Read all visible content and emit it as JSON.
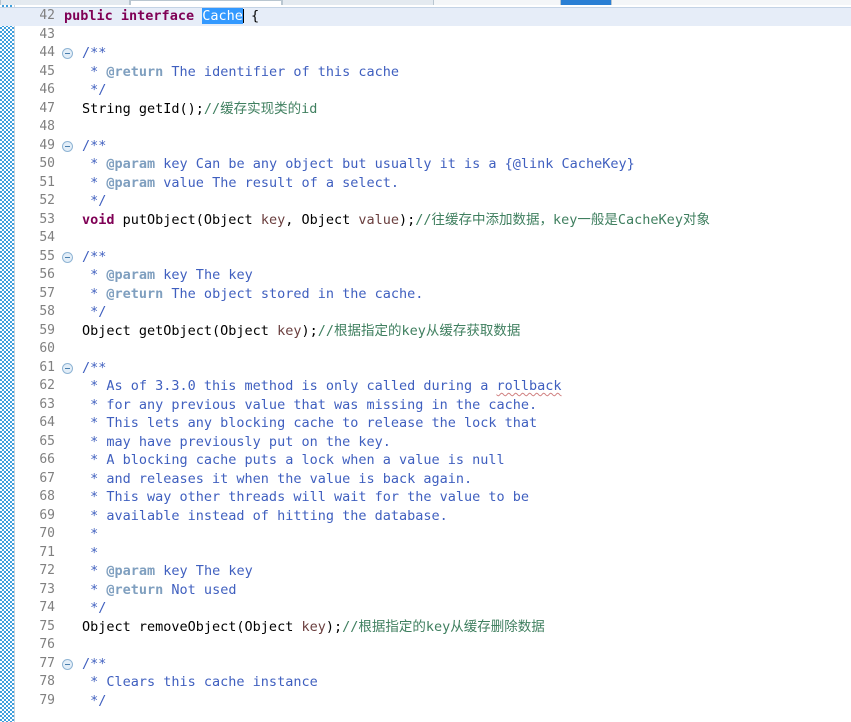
{
  "window": {
    "app": "eclipse-java-editor",
    "colors": {
      "keyword": "#7f0055",
      "javadoc": "#3f5fbf",
      "javadoc_tag": "#7f9fbf",
      "line_comment": "#3f7f5f",
      "parameter": "#6a3e3e",
      "selection_bg": "#3399ff",
      "current_line_bg": "#e6edf8",
      "line_number": "#808080",
      "change_bar": "#1e8fd8"
    }
  },
  "tabs": [
    {
      "label": "",
      "state": "inactive"
    },
    {
      "label": "",
      "state": "active"
    },
    {
      "label": "",
      "state": "inactive"
    },
    {
      "label": "",
      "state": "selected"
    }
  ],
  "editor": {
    "selected_text": "Cache",
    "current_line": 42,
    "first_visible_line": 42,
    "last_visible_line": 79,
    "lines": [
      {
        "n": "42",
        "fold": false,
        "indent": 0,
        "current": true,
        "tokens": [
          {
            "t": "public",
            "c": "kw"
          },
          {
            "t": " ",
            "c": "plain"
          },
          {
            "t": "interface",
            "c": "kw"
          },
          {
            "t": " ",
            "c": "plain"
          },
          {
            "t": "Cache",
            "c": "selected"
          },
          {
            "t": "caret",
            "c": "caret"
          },
          {
            "t": " {",
            "c": "plain"
          }
        ]
      },
      {
        "n": "43",
        "fold": false,
        "indent": 0,
        "current": false,
        "tokens": []
      },
      {
        "n": "44",
        "fold": true,
        "indent": 1,
        "current": false,
        "tokens": [
          {
            "t": "/**",
            "c": "doc"
          }
        ]
      },
      {
        "n": "45",
        "fold": false,
        "indent": 1,
        "current": false,
        "tokens": [
          {
            "t": " * ",
            "c": "doc"
          },
          {
            "t": "@return",
            "c": "doctag"
          },
          {
            "t": " The identifier of this cache",
            "c": "doc"
          }
        ]
      },
      {
        "n": "46",
        "fold": false,
        "indent": 1,
        "current": false,
        "tokens": [
          {
            "t": " */",
            "c": "doc"
          }
        ]
      },
      {
        "n": "47",
        "fold": false,
        "indent": 1,
        "current": false,
        "tokens": [
          {
            "t": "String getId();",
            "c": "plain"
          },
          {
            "t": "//缓存实现类的id",
            "c": "cmt"
          }
        ]
      },
      {
        "n": "48",
        "fold": false,
        "indent": 0,
        "current": false,
        "tokens": []
      },
      {
        "n": "49",
        "fold": true,
        "indent": 1,
        "current": false,
        "tokens": [
          {
            "t": "/**",
            "c": "doc"
          }
        ]
      },
      {
        "n": "50",
        "fold": false,
        "indent": 1,
        "current": false,
        "tokens": [
          {
            "t": " * ",
            "c": "doc"
          },
          {
            "t": "@param",
            "c": "doctag"
          },
          {
            "t": " key Can be any object but usually it is a {@link CacheKey}",
            "c": "doc"
          }
        ]
      },
      {
        "n": "51",
        "fold": false,
        "indent": 1,
        "current": false,
        "tokens": [
          {
            "t": " * ",
            "c": "doc"
          },
          {
            "t": "@param",
            "c": "doctag"
          },
          {
            "t": " value The result of a select.",
            "c": "doc"
          }
        ]
      },
      {
        "n": "52",
        "fold": false,
        "indent": 1,
        "current": false,
        "tokens": [
          {
            "t": " */",
            "c": "doc"
          }
        ]
      },
      {
        "n": "53",
        "fold": false,
        "indent": 1,
        "current": false,
        "tokens": [
          {
            "t": "void",
            "c": "kw"
          },
          {
            "t": " putObject(Object ",
            "c": "plain"
          },
          {
            "t": "key",
            "c": "param"
          },
          {
            "t": ", Object ",
            "c": "plain"
          },
          {
            "t": "value",
            "c": "param"
          },
          {
            "t": ");",
            "c": "plain"
          },
          {
            "t": "//往缓存中添加数据，key一般是CacheKey对象",
            "c": "cmt"
          }
        ]
      },
      {
        "n": "54",
        "fold": false,
        "indent": 0,
        "current": false,
        "tokens": []
      },
      {
        "n": "55",
        "fold": true,
        "indent": 1,
        "current": false,
        "tokens": [
          {
            "t": "/**",
            "c": "doc"
          }
        ]
      },
      {
        "n": "56",
        "fold": false,
        "indent": 1,
        "current": false,
        "tokens": [
          {
            "t": " * ",
            "c": "doc"
          },
          {
            "t": "@param",
            "c": "doctag"
          },
          {
            "t": " key The key",
            "c": "doc"
          }
        ]
      },
      {
        "n": "57",
        "fold": false,
        "indent": 1,
        "current": false,
        "tokens": [
          {
            "t": " * ",
            "c": "doc"
          },
          {
            "t": "@return",
            "c": "doctag"
          },
          {
            "t": " The object stored in the cache.",
            "c": "doc"
          }
        ]
      },
      {
        "n": "58",
        "fold": false,
        "indent": 1,
        "current": false,
        "tokens": [
          {
            "t": " */",
            "c": "doc"
          }
        ]
      },
      {
        "n": "59",
        "fold": false,
        "indent": 1,
        "current": false,
        "tokens": [
          {
            "t": "Object getObject(Object ",
            "c": "plain"
          },
          {
            "t": "key",
            "c": "param"
          },
          {
            "t": ");",
            "c": "plain"
          },
          {
            "t": "//根据指定的key从缓存获取数据",
            "c": "cmt"
          }
        ]
      },
      {
        "n": "60",
        "fold": false,
        "indent": 0,
        "current": false,
        "tokens": []
      },
      {
        "n": "61",
        "fold": true,
        "indent": 1,
        "current": false,
        "tokens": [
          {
            "t": "/**",
            "c": "doc"
          }
        ]
      },
      {
        "n": "62",
        "fold": false,
        "indent": 1,
        "current": false,
        "tokens": [
          {
            "t": " * As of 3.3.0 this method is only called during a ",
            "c": "doc"
          },
          {
            "t": "rollback",
            "c": "doc squig"
          }
        ]
      },
      {
        "n": "63",
        "fold": false,
        "indent": 1,
        "current": false,
        "tokens": [
          {
            "t": " * for any previous value that was missing in the cache.",
            "c": "doc"
          }
        ]
      },
      {
        "n": "64",
        "fold": false,
        "indent": 1,
        "current": false,
        "tokens": [
          {
            "t": " * This lets any blocking cache to release the lock that",
            "c": "doc"
          }
        ]
      },
      {
        "n": "65",
        "fold": false,
        "indent": 1,
        "current": false,
        "tokens": [
          {
            "t": " * may have previously put on the key.",
            "c": "doc"
          }
        ]
      },
      {
        "n": "66",
        "fold": false,
        "indent": 1,
        "current": false,
        "tokens": [
          {
            "t": " * A blocking cache puts a lock when a value is null",
            "c": "doc"
          }
        ]
      },
      {
        "n": "67",
        "fold": false,
        "indent": 1,
        "current": false,
        "tokens": [
          {
            "t": " * and releases it when the value is back again.",
            "c": "doc"
          }
        ]
      },
      {
        "n": "68",
        "fold": false,
        "indent": 1,
        "current": false,
        "tokens": [
          {
            "t": " * This way other threads will wait for the value to be",
            "c": "doc"
          }
        ]
      },
      {
        "n": "69",
        "fold": false,
        "indent": 1,
        "current": false,
        "tokens": [
          {
            "t": " * available instead of hitting the database.",
            "c": "doc"
          }
        ]
      },
      {
        "n": "70",
        "fold": false,
        "indent": 1,
        "current": false,
        "tokens": [
          {
            "t": " *",
            "c": "doc"
          }
        ]
      },
      {
        "n": "71",
        "fold": false,
        "indent": 1,
        "current": false,
        "tokens": [
          {
            "t": " *",
            "c": "doc"
          }
        ]
      },
      {
        "n": "72",
        "fold": false,
        "indent": 1,
        "current": false,
        "tokens": [
          {
            "t": " * ",
            "c": "doc"
          },
          {
            "t": "@param",
            "c": "doctag"
          },
          {
            "t": " key The key",
            "c": "doc"
          }
        ]
      },
      {
        "n": "73",
        "fold": false,
        "indent": 1,
        "current": false,
        "tokens": [
          {
            "t": " * ",
            "c": "doc"
          },
          {
            "t": "@return",
            "c": "doctag"
          },
          {
            "t": " Not used",
            "c": "doc"
          }
        ]
      },
      {
        "n": "74",
        "fold": false,
        "indent": 1,
        "current": false,
        "tokens": [
          {
            "t": " */",
            "c": "doc"
          }
        ]
      },
      {
        "n": "75",
        "fold": false,
        "indent": 1,
        "current": false,
        "tokens": [
          {
            "t": "Object removeObject(Object ",
            "c": "plain"
          },
          {
            "t": "key",
            "c": "param"
          },
          {
            "t": ");",
            "c": "plain"
          },
          {
            "t": "//根据指定的key从缓存删除数据",
            "c": "cmt"
          }
        ]
      },
      {
        "n": "76",
        "fold": false,
        "indent": 0,
        "current": false,
        "tokens": []
      },
      {
        "n": "77",
        "fold": true,
        "indent": 1,
        "current": false,
        "tokens": [
          {
            "t": "/**",
            "c": "doc"
          }
        ]
      },
      {
        "n": "78",
        "fold": false,
        "indent": 1,
        "current": false,
        "tokens": [
          {
            "t": " * Clears this cache instance",
            "c": "doc"
          }
        ]
      },
      {
        "n": "79",
        "fold": false,
        "indent": 1,
        "current": false,
        "tokens": [
          {
            "t": " */",
            "c": "doc"
          }
        ]
      }
    ]
  }
}
